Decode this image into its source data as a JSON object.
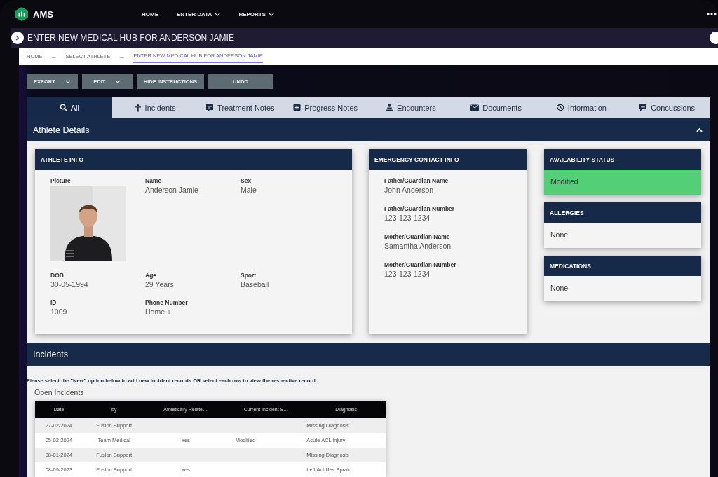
{
  "app": {
    "name": "AMS"
  },
  "nav": [
    {
      "label": "HOME",
      "dropdown": false
    },
    {
      "label": "ENTER DATA",
      "dropdown": true
    },
    {
      "label": "REPORTS",
      "dropdown": true
    }
  ],
  "page_title": "ENTER NEW MEDICAL HUB FOR ANDERSON JAMIE",
  "breadcrumb": [
    {
      "label": "HOME",
      "selected": false
    },
    {
      "label": "SELECT ATHLETE",
      "selected": false
    },
    {
      "label": "ENTER NEW MEDICAL HUB FOR ANDERSON JAMIE",
      "selected": true
    }
  ],
  "separator": "→",
  "toolbar": [
    {
      "label": "EXPORT",
      "dropdown": true
    },
    {
      "label": "EDIT",
      "dropdown": true
    },
    {
      "label": "HIDE INSTRUCTIONS",
      "dropdown": false
    },
    {
      "label": "UNDO",
      "dropdown": false
    }
  ],
  "tabs": [
    {
      "label": "All",
      "selected": true
    },
    {
      "label": "Incidents",
      "selected": false
    },
    {
      "label": "Treatment Notes",
      "selected": false
    },
    {
      "label": "Progress Notes",
      "selected": false
    },
    {
      "label": "Encounters",
      "selected": false
    },
    {
      "label": "Documents",
      "selected": false
    },
    {
      "label": "Information",
      "selected": false
    },
    {
      "label": "Concussions",
      "selected": false
    }
  ],
  "athlete_details": {
    "title": "Athlete Details",
    "expanded": true,
    "athlete_info": {
      "title": "ATHLETE INFO",
      "picture_label": "Picture",
      "fields": [
        {
          "label": "Name",
          "value": "Anderson Jamie"
        },
        {
          "label": "Sex",
          "value": "Male"
        },
        {
          "label": "DOB",
          "value": "30-05-1994"
        },
        {
          "label": "Age",
          "value": "29 Years"
        },
        {
          "label": "Sport",
          "value": "Baseball"
        },
        {
          "label": "ID",
          "value": "1009"
        },
        {
          "label": "Phone Number",
          "value": "Home +"
        }
      ]
    },
    "emergency_contact": {
      "title": "EMERGENCY CONTACT INFO",
      "fields": [
        {
          "label": "Father/Guardian Name",
          "value": "John Anderson"
        },
        {
          "label": "Father/Guardian Number",
          "value": "123-123-1234"
        },
        {
          "label": "Mother/Guardian Name",
          "value": "Samantha Anderson"
        },
        {
          "label": "Mother/Guardian Number",
          "value": "123-123-1234"
        }
      ]
    },
    "side_cards": [
      {
        "title": "AVAILABILITY STATUS",
        "value": "Modified",
        "kind": "status"
      },
      {
        "title": "ALLERGIES",
        "value": "None",
        "kind": "plain"
      },
      {
        "title": "MEDICATIONS",
        "value": "None",
        "kind": "plain"
      }
    ]
  },
  "incidents": {
    "title": "Incidents",
    "instruction": "Please select the \"New\" option below to add new incident records OR select each row to view the respective record.",
    "subtitle": "Open Incidents",
    "table": {
      "columns": [
        "Date",
        "by",
        "Athletically Relate…",
        "Current Incident S…",
        "Diagnosis"
      ],
      "rows": [
        [
          "27-02-2024",
          "Fusion Support",
          "",
          "",
          "Missing Diagnosis"
        ],
        [
          "05-02-2024",
          "Team Medical",
          "Yes",
          "Modified",
          "Acute ACL injury"
        ],
        [
          "08-01-2024",
          "Fusion Support",
          "",
          "",
          "Missing Diagnosis"
        ],
        [
          "08-09-2023",
          "Fusion Support",
          "Yes",
          "",
          "Left Achilles Sprain"
        ]
      ]
    }
  }
}
